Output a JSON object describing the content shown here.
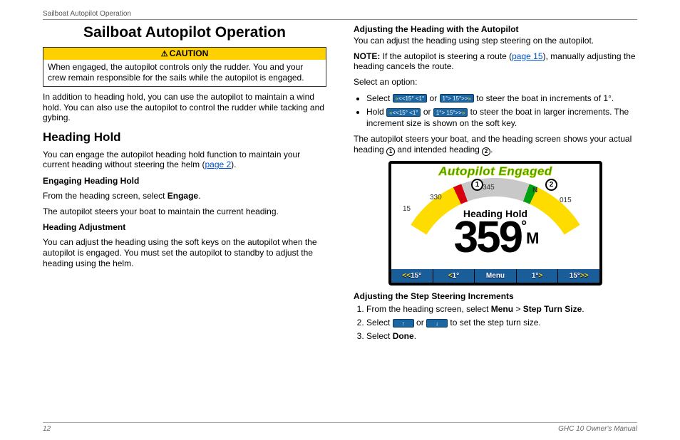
{
  "running_head": "Sailboat Autopilot Operation",
  "title": "Sailboat Autopilot Operation",
  "caution": {
    "label": "CAUTION",
    "text": "When engaged, the autopilot controls only the rudder. You and your crew remain responsible for the sails while the autopilot is engaged."
  },
  "intro": "In addition to heading hold, you can use the autopilot to maintain a wind hold. You can also use the autopilot to control the rudder while tacking and gybing.",
  "heading_hold": {
    "heading": "Heading Hold",
    "text_pre": "You can engage the autopilot heading hold function to maintain your current heading without steering the helm (",
    "page_ref": "page 2",
    "text_post": ")."
  },
  "engaging": {
    "heading": "Engaging Heading Hold",
    "line1_pre": "From the heading screen, select ",
    "line1_bold": "Engage",
    "line1_post": ".",
    "line2": "The autopilot steers your boat to maintain the current heading."
  },
  "heading_adj": {
    "heading": "Heading Adjustment",
    "text": "You can adjust the heading using the soft keys on the autopilot when the autopilot is engaged. You must set the autopilot to standby to adjust the heading using the helm."
  },
  "adj_with_ap": {
    "heading": "Adjusting the Heading with the Autopilot",
    "intro": "You can adjust the heading using step steering on the autopilot.",
    "note_label": "NOTE:",
    "note_pre": " If the autopilot is steering a route (",
    "note_ref": "page 15",
    "note_post": "), manually adjusting the heading cancels the route.",
    "select_label": "Select an option:",
    "b1_pre": "Select ",
    "b1_mid": " or ",
    "b1_post": " to steer the boat in increments of 1°.",
    "b2_pre": "Hold ",
    "b2_mid": " or ",
    "b2_post": " to steer the boat in larger increments. The increment size is shown on the soft key.",
    "tail_pre": "The autopilot steers your boat, and the heading screen shows your actual heading ",
    "tail_mid": " and intended heading ",
    "tail_post": "."
  },
  "softkeys": {
    "left15": "<<15°",
    "left1": "<1°",
    "right1": "1°>",
    "right15": "15°>>",
    "menu": "Menu",
    "up": "↑",
    "down": "↓"
  },
  "gauge": {
    "title": "Autopilot Engaged",
    "mode": "Heading Hold",
    "reading": "359",
    "unit": "M",
    "n": "N",
    "t330": "330",
    "t345": "345",
    "t015": "015",
    "t15": "15"
  },
  "adj_steps": {
    "heading": "Adjusting the Step Steering Increments",
    "s1_pre": "From the heading screen, select ",
    "s1_b1": "Menu",
    "s1_mid": " > ",
    "s1_b2": "Step Turn Size",
    "s1_post": ".",
    "s2_pre": "Select ",
    "s2_mid": " or ",
    "s2_post": " to set the step turn size.",
    "s3_pre": "Select ",
    "s3_b": "Done",
    "s3_post": "."
  },
  "footer": {
    "page": "12",
    "manual": "GHC 10 Owner's Manual"
  }
}
